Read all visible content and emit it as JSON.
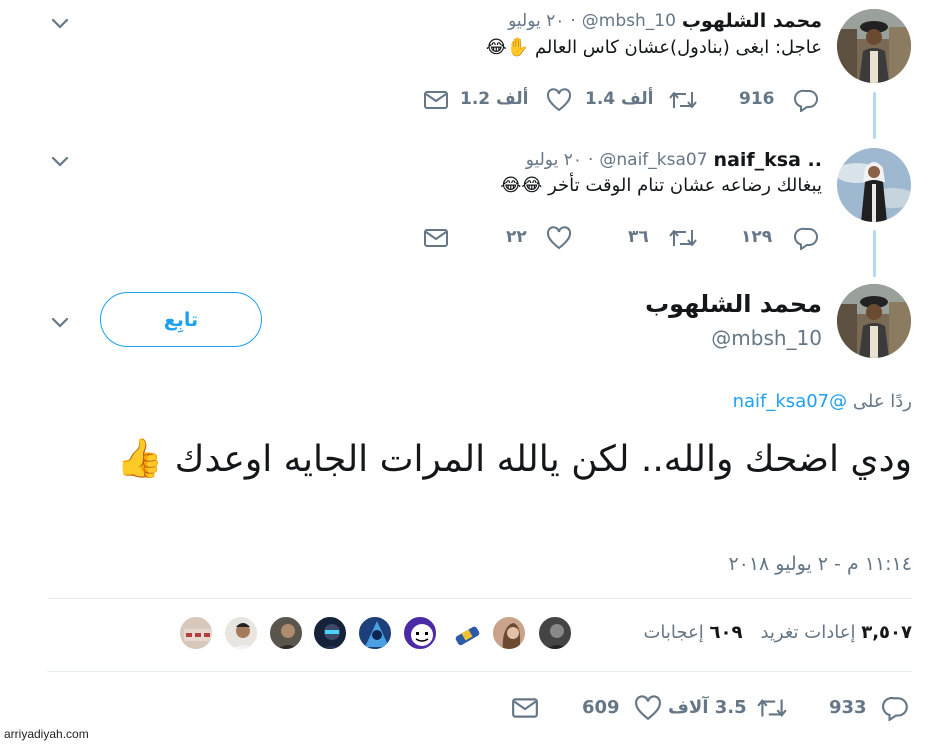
{
  "colors": {
    "accent": "#1da1f2",
    "grey": "#657786",
    "text": "#14171a",
    "thread": "#b5d9f2",
    "like": "#e0245e"
  },
  "tweet1": {
    "name": "محمد الشلهوب",
    "handle": "@mbsh_10",
    "dot": "·",
    "date": "٢٠ يوليو",
    "text": "عاجل: ابغى (بنادول)عشان كاس العالم",
    "emoji": "✋😂",
    "replies": "916",
    "retweets": "1.4 ألف",
    "likes": "1.2 ألف"
  },
  "tweet2": {
    "name": "naif_ksa ..",
    "handle": "@naif_ksa07",
    "dot": "·",
    "date": "٢٠ يوليو",
    "text": "يبغالك رضاعه عشان تنام الوقت تأخر",
    "emoji": "😂😂",
    "replies": "١٢٩",
    "retweets": "٣٦",
    "likes": "٢٢"
  },
  "main": {
    "name": "محمد الشلهوب",
    "handle": "@mbsh_10",
    "follow_label": "تابِع",
    "reply_prefix": "ردًا على",
    "reply_to": "@naif_ksa07",
    "text": "ودي اضحك والله.. لكن يالله المرات الجايه اوعدك",
    "emoji": "👍",
    "timestamp": "١١:١٤ م - ٢ يوليو ٢٠١٨",
    "retweets_count": "٣,٥٠٧",
    "retweets_label": "إعادات تغريد",
    "likes_count": "٦٠٩",
    "likes_label": "إعجابات",
    "replies": "933",
    "retweets": "3.5 آلاف",
    "likes": "609"
  },
  "watermark": "arriyadiyah.com",
  "icons": [
    "chevron-down-icon",
    "reply-icon",
    "retweet-icon",
    "heart-icon",
    "mail-icon"
  ]
}
